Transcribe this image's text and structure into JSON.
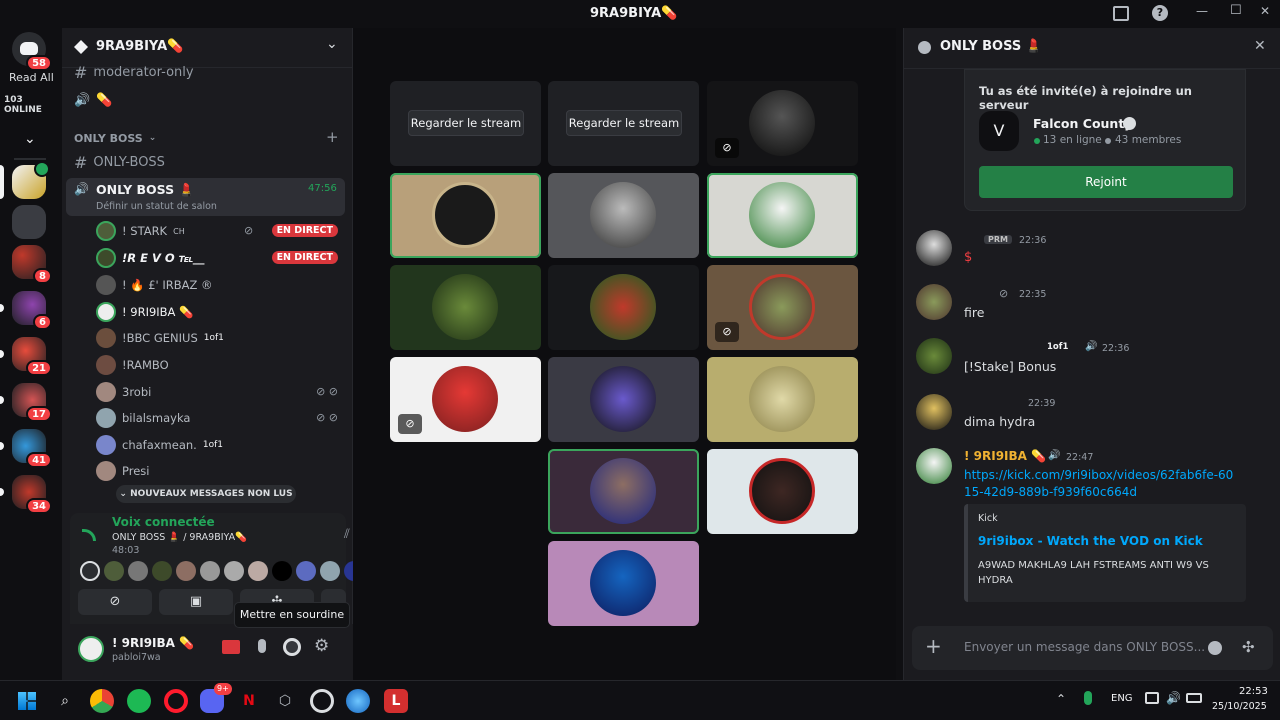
{
  "window": {
    "title": "9RA9BIYA💊",
    "help_icon": "?",
    "min": "—",
    "max": "☐",
    "close": "✕"
  },
  "rail": {
    "home_badge": "58",
    "read_all": "Read All",
    "online": "103 ONLINE",
    "badges": [
      "8",
      "6",
      "21",
      "17",
      "41",
      "34"
    ]
  },
  "server": {
    "name": "9RA9BIYA💊",
    "moderator_channel": "moderator-only",
    "voice_extra": "💊",
    "category": "ONLY BOSS",
    "text_channel": "ONLY-BOSS",
    "voice_channel": "ONLY BOSS 💄",
    "voice_timer": "47:56",
    "voice_status": "Définir un statut de salon",
    "users": [
      {
        "name": "! STARK",
        "suffix": "CH",
        "live": true
      },
      {
        "name": "!R E V O ℡__",
        "live": true
      },
      {
        "name": "! 🔥 £' IRBAZ ®",
        "live": false
      },
      {
        "name": "! 9RI9IBA 💊",
        "live": false
      },
      {
        "name": "!BBC GENIUS",
        "tag": "1of1",
        "live": false
      },
      {
        "name": "!RAMBO",
        "live": false
      },
      {
        "name": "3robi",
        "live": false
      },
      {
        "name": "bilalsmayka",
        "live": false
      },
      {
        "name": "chafaxmean.",
        "tag": "1of1",
        "live": false
      },
      {
        "name": "Presi",
        "live": false
      }
    ],
    "live_label": "EN DIRECT",
    "unread_banner": "NOUVEAUX MESSAGES NON LUS"
  },
  "voice_panel": {
    "status": "Voix connectée",
    "channel": "ONLY BOSS 💄 / 9RA9BIYA💊",
    "timer": "48:03"
  },
  "user_panel": {
    "name": "! 9RI9IBA 💊",
    "handle": "pabloi7wa",
    "tooltip": "Mettre en sourdine"
  },
  "stage": {
    "watch_label": "Regarder le stream"
  },
  "chat": {
    "title": "ONLY BOSS 💄",
    "invite": {
      "heading": "Tu as été invité(e) à rejoindre un serveur",
      "server": "Falcon County",
      "online": "13 en ligne",
      "members": "43 membres",
      "join": "Rejoint"
    },
    "messages": [
      {
        "tag": "PRM",
        "time": "22:36",
        "text": "$"
      },
      {
        "time": "22:35",
        "text": "fire"
      },
      {
        "tag": "1of1",
        "time": "22:36",
        "text": "[!Stake] Bonus"
      },
      {
        "time": "22:39",
        "text": "dima hydra"
      },
      {
        "author": "! 9RI9IBA 💊",
        "time": "22:47",
        "link": "https://kick.com/9ri9ibox/videos/62fab6fe-6015-42d9-889b-f939f60c664d"
      }
    ],
    "embed": {
      "provider": "Kick",
      "title": "9ri9ibox - Watch the VOD on Kick",
      "desc": "A9WAD MAKHLA9 LAH FSTREAMS ANTI W9 VS HYDRA"
    },
    "input_placeholder": "Envoyer un message dans ONLY BOSS..."
  },
  "taskbar": {
    "lang": "ENG",
    "time": "22:53",
    "date": "25/10/2025",
    "discord_badge": "9+"
  },
  "colors": {
    "accent_green": "#248046",
    "live_red": "#da373c",
    "speaking": "#3ba55c",
    "link": "#00a8fc"
  }
}
